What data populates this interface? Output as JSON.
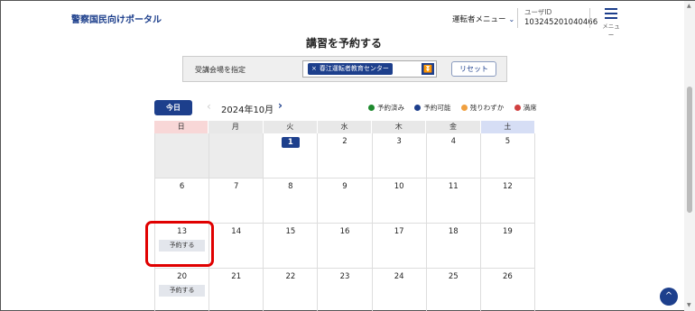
{
  "header": {
    "portal_title": "警察国民向けポータル",
    "driver_menu": "運転者メニュー",
    "user_label": "ユーザID",
    "user_id": "103245201040466",
    "menu_label": "メニュー"
  },
  "page": {
    "title": "講習を予約する"
  },
  "venue": {
    "label": "受講会場を指定",
    "selected": "春江運転者教育センター",
    "remove": "×",
    "dropdown": "⏬",
    "reset_label": "リセット"
  },
  "calendar": {
    "today_label": "今日",
    "prev": "‹",
    "month_label": "2024年10月",
    "next": "›",
    "weekdays": [
      "日",
      "月",
      "火",
      "水",
      "木",
      "金",
      "土"
    ],
    "reserve_label": "予約する",
    "weeks": [
      [
        "",
        "",
        "1",
        "2",
        "3",
        "4",
        "5"
      ],
      [
        "6",
        "7",
        "8",
        "9",
        "10",
        "11",
        "12"
      ],
      [
        "13",
        "14",
        "15",
        "16",
        "17",
        "18",
        "19"
      ],
      [
        "20",
        "21",
        "22",
        "23",
        "24",
        "25",
        "26"
      ]
    ]
  },
  "legend": [
    {
      "label": "予約済み",
      "color": "#1e8a2e"
    },
    {
      "label": "予約可能",
      "color": "#1d3f8c"
    },
    {
      "label": "残りわずか",
      "color": "#f0a040"
    },
    {
      "label": "満席",
      "color": "#d04040"
    }
  ],
  "scroll_top": "^"
}
